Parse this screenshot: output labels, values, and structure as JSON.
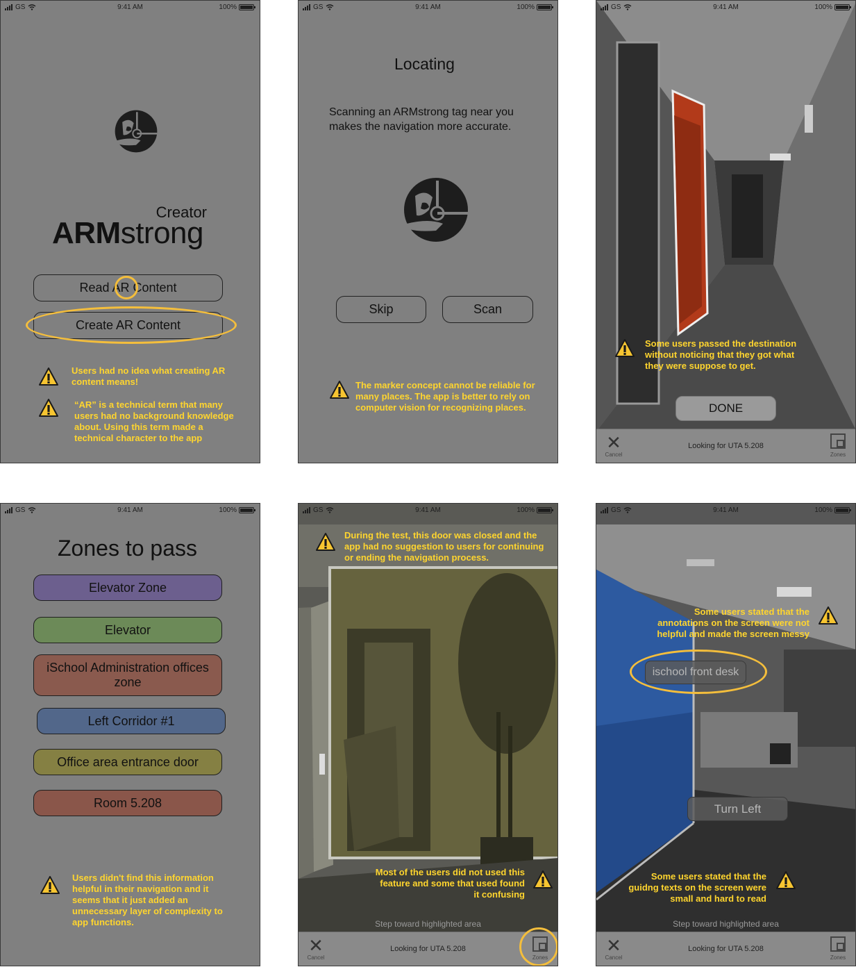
{
  "status_bar": {
    "carrier": "GS",
    "time": "9:41 AM",
    "battery": "100%"
  },
  "screen1": {
    "logo_sub": "Creator",
    "logo_bold": "ARM",
    "logo_light": "strong",
    "read_button": "Read AR Content",
    "create_button": "Create AR Content",
    "warning1": "Users had no idea what creating AR content means!",
    "warning2": "“AR” is a technical term that many users had no background knowledge about. Using this term made a technical character to the app"
  },
  "screen2": {
    "title": "Locating",
    "description": "Scanning an ARMstrong tag near you makes the navigation more accurate.",
    "skip_button": "Skip",
    "scan_button": "Scan",
    "warning": "The marker concept cannot be reliable for many places. The app is better to rely on computer vision for recognizing places."
  },
  "screen3": {
    "warning": "Some users passed the destination without noticing that they got what they were suppose to get.",
    "done_button": "DONE",
    "cancel_label": "Cancel",
    "looking_for": "Looking for UTA 5.208",
    "zones_label": "Zones"
  },
  "screen4": {
    "title": "Zones to pass",
    "zones": [
      {
        "label": "Elevator Zone",
        "color": "#6c5f8e"
      },
      {
        "label": "Elevator",
        "color": "#6c8a58"
      },
      {
        "label": "iSchool Administration offices zone",
        "color": "#8a5a4e"
      },
      {
        "label": "Left Corridor #1",
        "color": "#52678a"
      },
      {
        "label": "Office area entrance door",
        "color": "#858043"
      },
      {
        "label": "Room 5.208",
        "color": "#8a564a"
      }
    ],
    "warning": "Users didn't find this information helpful in their navigation and it seems that it just added an unnecessary layer of complexity to app functions."
  },
  "screen5": {
    "warning_top": "During the test, this door was closed and the app had no suggestion to users for continuing or ending the navigation process.",
    "warning_bottom": "Most of the users did not used this feature and some that used found it confusing",
    "hint": "Step toward highlighted area",
    "cancel_label": "Cancel",
    "looking_for": "Looking for UTA 5.208",
    "zones_label": "Zones"
  },
  "screen6": {
    "warning_top": "Some users stated that the annotations on the screen were not helpful and made the screen messy",
    "front_desk_label": "ischool front desk",
    "turn_left_label": "Turn Left",
    "warning_bottom": "Some users stated that the guidng texts on the screen were small and hard to read",
    "hint": "Step toward highlighted area",
    "cancel_label": "Cancel",
    "looking_for": "Looking for UTA 5.208",
    "zones_label": "Zones"
  },
  "colors": {
    "warning_text": "#ffd52e",
    "highlight_ring": "#f4be3c",
    "screen_bg": "#808080"
  }
}
